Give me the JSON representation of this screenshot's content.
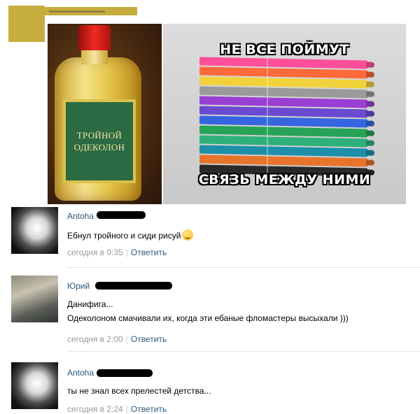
{
  "post": {
    "image": {
      "bottle_label": "ТРОЙНОЙ\nОДЕКОЛОН",
      "caption_top": "НЕ ВСЕ ПОЙМУТ",
      "caption_bottom": "СВЯЗЬ МЕЖДУ НИМИ",
      "marker_colors": [
        "#ff4f9a",
        "#ff6a3a",
        "#f2d23b",
        "#9a9a9a",
        "#9a3fd4",
        "#6a4ad0",
        "#3566e0",
        "#26a356",
        "#2fb07a",
        "#1d8fa8",
        "#e8732a",
        "#2a2a2a"
      ]
    }
  },
  "comments": [
    {
      "author": "Antoha",
      "lines": [
        "Ебнул тройного и сиди рисуй"
      ],
      "time": "сегодня в 0:35",
      "reply_label": "Ответить",
      "has_emoji": true
    },
    {
      "author": "Юрий",
      "lines": [
        "Данифига...",
        "Одеколоном смачивали их, когда эти ебаные фломастеры высыхали )))"
      ],
      "time": "сегодня в 2:00",
      "reply_label": "Ответить"
    },
    {
      "author": "Antoha",
      "lines": [
        "ты не знал всех прелестей детства..."
      ],
      "time": "сегодня в 2:24",
      "reply_label": "Ответить"
    }
  ]
}
